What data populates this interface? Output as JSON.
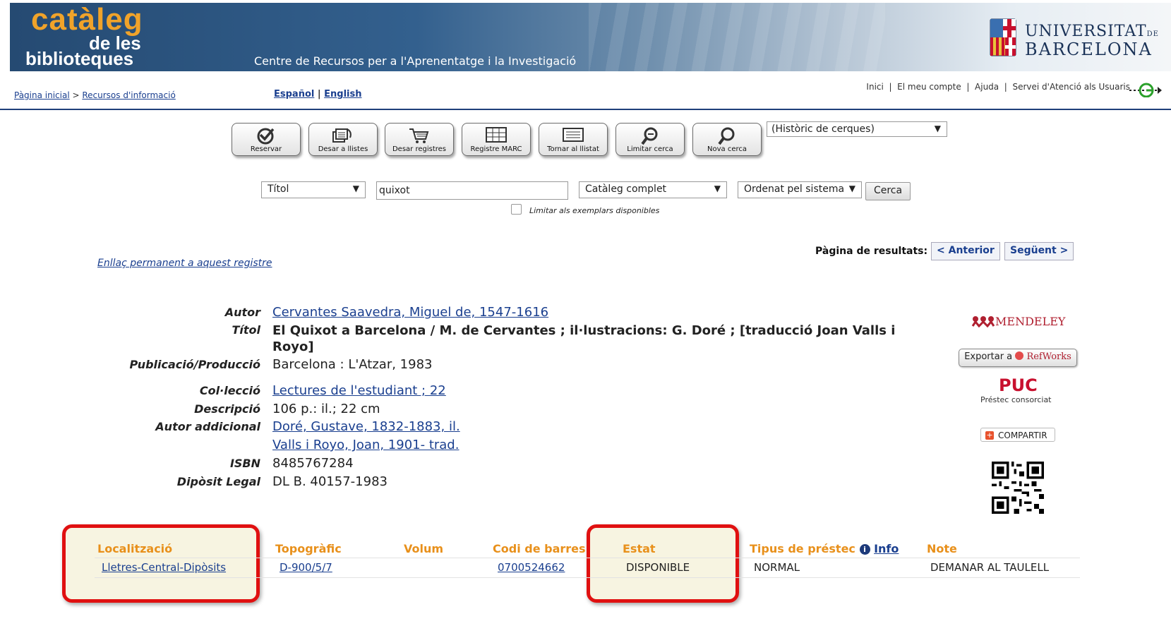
{
  "header": {
    "logo_line1": "catàleg",
    "logo_line2": "de les",
    "logo_line3": "biblioteques",
    "centre_name": "Centre de Recursos per a l'Aprenentatge i la Investigació",
    "university_line1": "UNIVERSITAT",
    "university_de": "DE",
    "university_line2": "BARCELONA"
  },
  "breadcrumb": {
    "home": "Pàgina inicial",
    "separator": " > ",
    "section": "Recursos d'informació"
  },
  "languages": {
    "es": "Español",
    "sep": " | ",
    "en": "English"
  },
  "top_links": [
    "Inici",
    "El meu compte",
    "Ajuda",
    "Servei d'Atenció als Usuaris"
  ],
  "toolbar": {
    "reservar": "Reservar",
    "desar_llistes": "Desar a llistes",
    "desar_registres": "Desar registres",
    "registre_marc": "Registre MARC",
    "tornar_llistat": "Tornar al llistat",
    "limitar_cerca": "Limitar cerca",
    "nova_cerca": "Nova cerca",
    "history_select": "(Històric de cerques)"
  },
  "search": {
    "field_select": "Títol",
    "query": "quixot",
    "scope_select": "Catàleg complet",
    "sort_select": "Ordenat pel sistema",
    "submit": "Cerca",
    "limit_label": "Limitar als exemplars disponibles"
  },
  "permalink": "Enllaç permanent a aquest registre",
  "pagination": {
    "label": "Pàgina de resultats:",
    "prev": "< Anterior",
    "next": "Següent >"
  },
  "record": {
    "autor_label": "Autor",
    "autor": "Cervantes Saavedra, Miguel de, 1547-1616",
    "titol_label": "Títol",
    "titol": "El Quixot a Barcelona / M. de Cervantes ; il·lustracions: G. Doré ; [traducció Joan Valls i Royo]",
    "publicacio_label": "Publicació/Producció",
    "publicacio": "Barcelona : L'Atzar, 1983",
    "colleccio_label": "Col·lecció",
    "colleccio": "Lectures de l'estudiant ; 22",
    "descripcio_label": "Descripció",
    "descripcio": "106 p.: il.; 22 cm",
    "autor_addicional_label": "Autor addicional",
    "autor_addicional_1": "Doré, Gustave, 1832-1883, il.",
    "autor_addicional_2": "Valls i Royo, Joan, 1901- trad.",
    "isbn_label": "ISBN",
    "isbn": "8485767284",
    "diposit_label": "Dipòsit Legal",
    "diposit": "DL B. 40157-1983"
  },
  "sidebar": {
    "mendeley": "MENDELEY",
    "refworks_prefix": "Exportar a",
    "refworks": "RefWorks",
    "puc": "PUC",
    "puc_sub": "Préstec consorciat",
    "compartir": "COMPARTIR"
  },
  "holdings": {
    "headers": {
      "localitzacio": "Localització",
      "topografic": "Topogràfic",
      "volum": "Volum",
      "codi_barres": "Codi de barres",
      "estat": "Estat",
      "tipus_prestec": "Tipus de préstec",
      "info": "Info",
      "note": "Note"
    },
    "rows": [
      {
        "localitzacio": "Lletres-Central-Dipòsits",
        "topografic": "D-900/5/7",
        "volum": "",
        "codi_barres": "0700524662",
        "estat": "DISPONIBLE",
        "tipus_prestec": "NORMAL",
        "note": "DEMANAR AL TAULELL"
      }
    ]
  },
  "colors": {
    "header_accent": "#f0a32a",
    "link": "#1a3f8f",
    "table_header": "#e8901b",
    "highlight_border": "#e01010",
    "nav_rule": "#1f3f7a"
  }
}
